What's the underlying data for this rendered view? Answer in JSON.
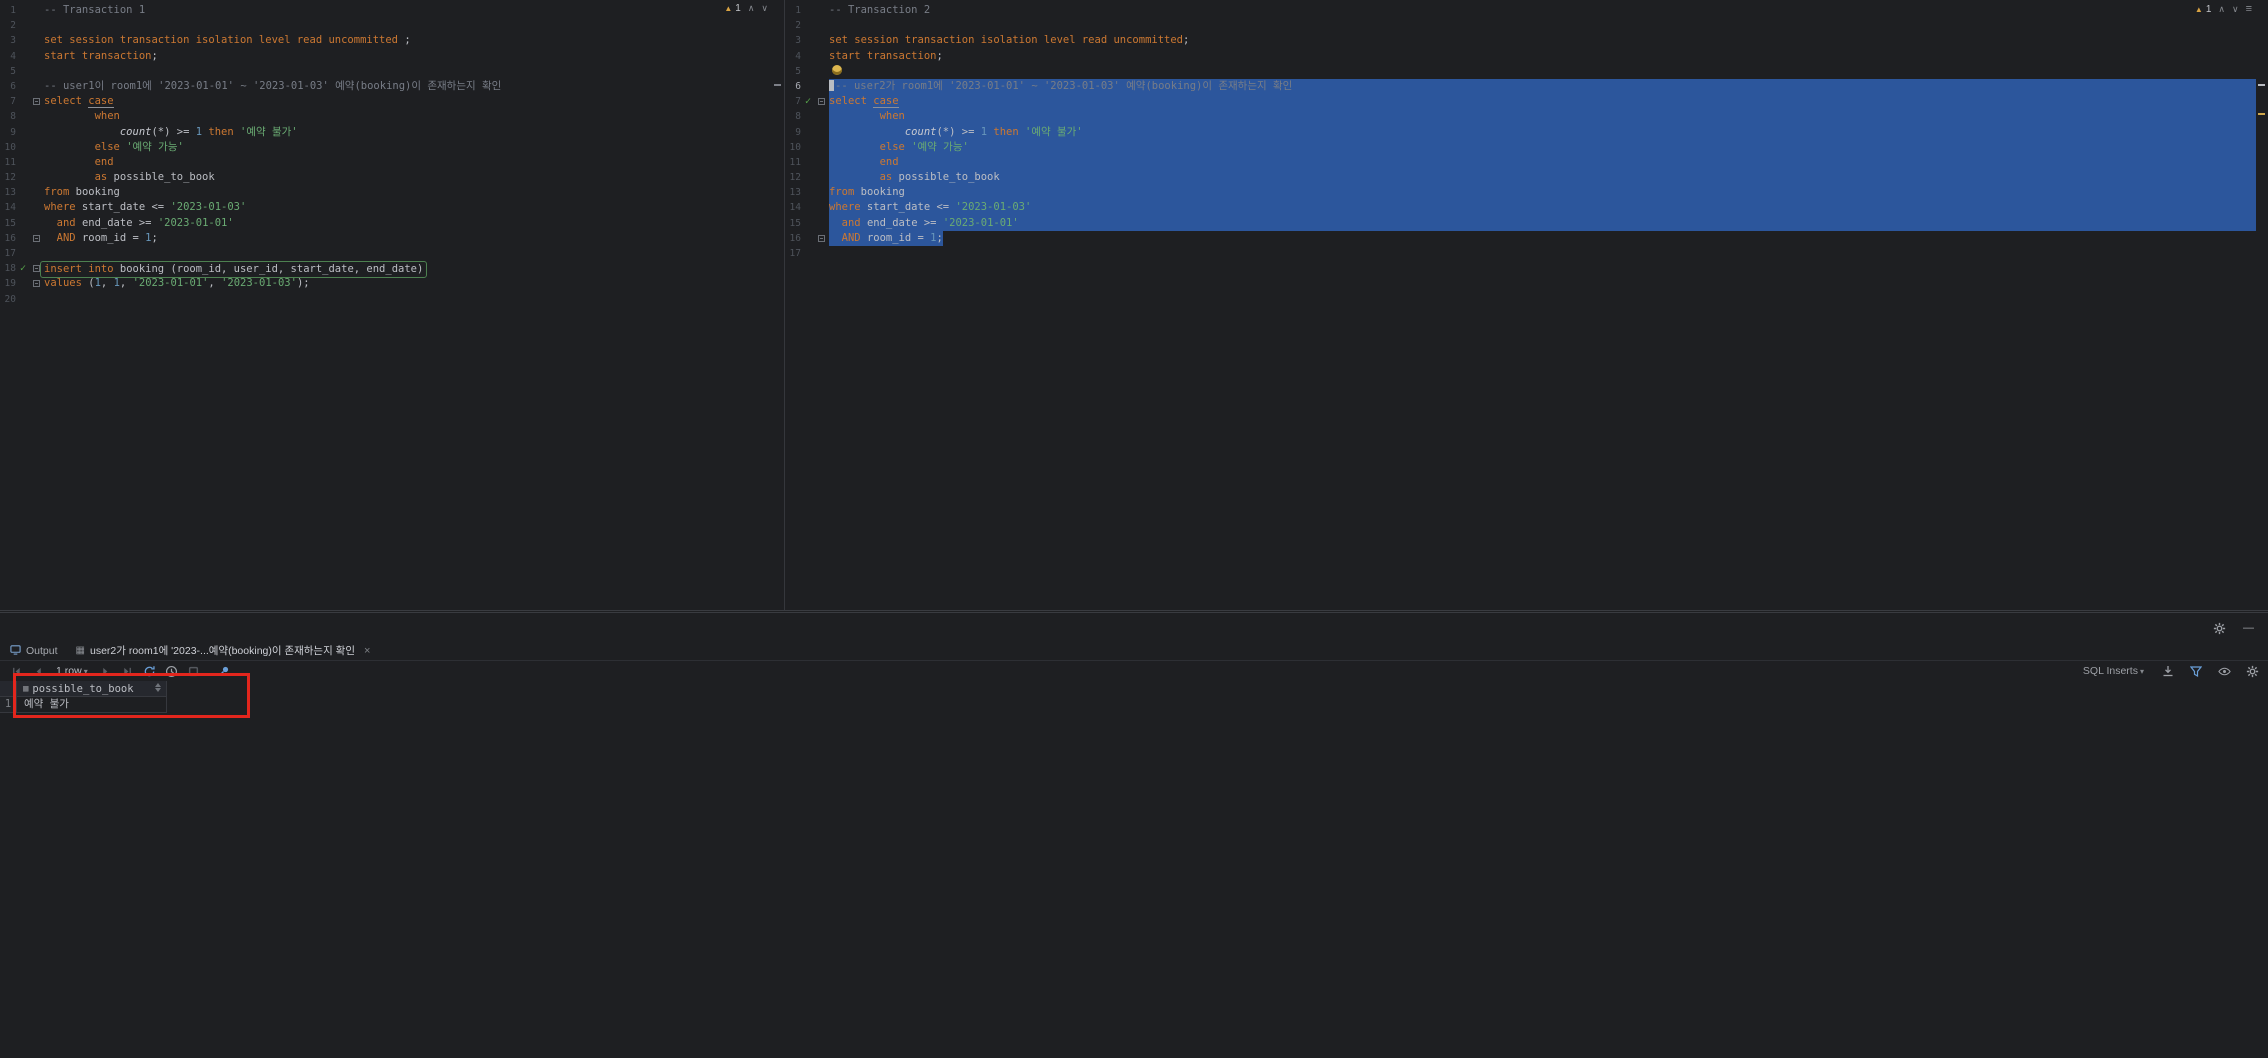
{
  "colors": {
    "selection_blue": "#2c569c",
    "keyword_orange": "#cc7832",
    "string_green": "#6aab73",
    "number_blue": "#6897bb",
    "comment_gray": "#787d87",
    "warning_yellow": "#d9a343",
    "exec_check_green": "#57a64a",
    "annotation_red": "#e3261d",
    "editor_bg": "#1e1f22"
  },
  "editors": [
    {
      "name": "transaction-1",
      "warnings": "1",
      "lines": [
        {
          "n": "1",
          "seg": [
            [
              "cmt",
              "-- Transaction 1"
            ]
          ]
        },
        {
          "n": "2"
        },
        {
          "n": "3",
          "seg": [
            [
              "kw",
              "set session transaction isolation level read uncommitted"
            ],
            [
              "def",
              " ;"
            ]
          ]
        },
        {
          "n": "4",
          "seg": [
            [
              "kw",
              "start transaction"
            ],
            [
              "def",
              ";"
            ]
          ]
        },
        {
          "n": "5"
        },
        {
          "n": "6",
          "seg": [
            [
              "cmt",
              "-- user1이 room1에 '2023-01-01' ~ '2023-01-03' 예약(booking)이 존재하는지 확인"
            ]
          ]
        },
        {
          "n": "7",
          "fold": true,
          "seg": [
            [
              "kw",
              "select "
            ],
            [
              "kwu",
              "case"
            ]
          ]
        },
        {
          "n": "8",
          "seg": [
            [
              "def",
              "        "
            ],
            [
              "kw",
              "when"
            ]
          ]
        },
        {
          "n": "9",
          "seg": [
            [
              "def",
              "            "
            ],
            [
              "fn",
              "count"
            ],
            [
              "def",
              "(*) >= "
            ],
            [
              "num",
              "1"
            ],
            [
              "def",
              " "
            ],
            [
              "kw",
              "then"
            ],
            [
              "def",
              " "
            ],
            [
              "str",
              "'예약 불가'"
            ]
          ]
        },
        {
          "n": "10",
          "seg": [
            [
              "def",
              "        "
            ],
            [
              "kw",
              "else"
            ],
            [
              "def",
              " "
            ],
            [
              "str",
              "'예약 가능'"
            ]
          ]
        },
        {
          "n": "11",
          "seg": [
            [
              "def",
              "        "
            ],
            [
              "kw",
              "end"
            ]
          ]
        },
        {
          "n": "12",
          "seg": [
            [
              "def",
              "        "
            ],
            [
              "kw",
              "as"
            ],
            [
              "def",
              " possible_to_book"
            ]
          ]
        },
        {
          "n": "13",
          "seg": [
            [
              "kw",
              "from"
            ],
            [
              "def",
              " booking"
            ]
          ]
        },
        {
          "n": "14",
          "seg": [
            [
              "kw",
              "where"
            ],
            [
              "def",
              " start_date <= "
            ],
            [
              "str",
              "'2023-01-03'"
            ]
          ]
        },
        {
          "n": "15",
          "seg": [
            [
              "def",
              "  "
            ],
            [
              "kw",
              "and"
            ],
            [
              "def",
              " end_date >= "
            ],
            [
              "str",
              "'2023-01-01'"
            ]
          ]
        },
        {
          "n": "16",
          "fold": true,
          "seg": [
            [
              "def",
              "  "
            ],
            [
              "kw",
              "AND"
            ],
            [
              "def",
              " room_id = "
            ],
            [
              "num",
              "1"
            ],
            [
              "def",
              ";"
            ]
          ]
        },
        {
          "n": "17"
        },
        {
          "n": "18",
          "check": true,
          "fold": true,
          "exec": true,
          "seg": [
            [
              "kw",
              "insert into"
            ],
            [
              "def",
              " booking (room_id, user_id, start_date, end_date)"
            ]
          ]
        },
        {
          "n": "19",
          "fold": true,
          "seg": [
            [
              "kw",
              "values"
            ],
            [
              "def",
              " ("
            ],
            [
              "num",
              "1"
            ],
            [
              "def",
              ", "
            ],
            [
              "num",
              "1"
            ],
            [
              "def",
              ", "
            ],
            [
              "str",
              "'2023-01-01'"
            ],
            [
              "def",
              ", "
            ],
            [
              "str",
              "'2023-01-03'"
            ],
            [
              "def",
              ");"
            ]
          ]
        },
        {
          "n": "20"
        }
      ]
    },
    {
      "name": "transaction-2",
      "warnings": "1",
      "lines": [
        {
          "n": "1",
          "seg": [
            [
              "cmt",
              "-- Transaction 2"
            ]
          ]
        },
        {
          "n": "2"
        },
        {
          "n": "3",
          "seg": [
            [
              "kw",
              "set session transaction isolation level read uncommitted"
            ],
            [
              "def",
              ";"
            ]
          ]
        },
        {
          "n": "4",
          "seg": [
            [
              "kw",
              "start transaction"
            ],
            [
              "def",
              ";"
            ]
          ]
        },
        {
          "n": "5",
          "bulb": true
        },
        {
          "n": "6",
          "cur": true,
          "sel": true,
          "caret": true,
          "seg": [
            [
              "cmt",
              "-- user2가 room1에 '2023-01-01' ~ '2023-01-03' 예약(booking)이 존재하는지 확인"
            ]
          ]
        },
        {
          "n": "7",
          "check": true,
          "fold": true,
          "sel": true,
          "seg": [
            [
              "kw",
              "select "
            ],
            [
              "kwu",
              "case"
            ]
          ]
        },
        {
          "n": "8",
          "sel": true,
          "seg": [
            [
              "def",
              "        "
            ],
            [
              "kw",
              "when"
            ]
          ]
        },
        {
          "n": "9",
          "sel": true,
          "seg": [
            [
              "def",
              "            "
            ],
            [
              "fn",
              "count"
            ],
            [
              "def",
              "(*) >= "
            ],
            [
              "num",
              "1"
            ],
            [
              "def",
              " "
            ],
            [
              "kw",
              "then"
            ],
            [
              "def",
              " "
            ],
            [
              "str",
              "'예약 불가'"
            ]
          ]
        },
        {
          "n": "10",
          "sel": true,
          "seg": [
            [
              "def",
              "        "
            ],
            [
              "kw",
              "else"
            ],
            [
              "def",
              " "
            ],
            [
              "str",
              "'예약 가능'"
            ]
          ]
        },
        {
          "n": "11",
          "sel": true,
          "seg": [
            [
              "def",
              "        "
            ],
            [
              "kw",
              "end"
            ]
          ]
        },
        {
          "n": "12",
          "sel": true,
          "seg": [
            [
              "def",
              "        "
            ],
            [
              "kw",
              "as"
            ],
            [
              "def",
              " possible_to_book"
            ]
          ]
        },
        {
          "n": "13",
          "sel": true,
          "seg": [
            [
              "kw",
              "from"
            ],
            [
              "def",
              " booking"
            ]
          ]
        },
        {
          "n": "14",
          "sel": true,
          "seg": [
            [
              "kw",
              "where"
            ],
            [
              "def",
              " start_date <= "
            ],
            [
              "str",
              "'2023-01-03'"
            ]
          ]
        },
        {
          "n": "15",
          "sel": true,
          "seg": [
            [
              "def",
              "  "
            ],
            [
              "kw",
              "and"
            ],
            [
              "def",
              " end_date >= "
            ],
            [
              "str",
              "'2023-01-01'"
            ]
          ]
        },
        {
          "n": "16",
          "fold": true,
          "selText": true,
          "seg": [
            [
              "def",
              "  "
            ],
            [
              "kw",
              "AND"
            ],
            [
              "def",
              " room_id = "
            ],
            [
              "num",
              "1"
            ],
            [
              "def",
              ";"
            ]
          ]
        },
        {
          "n": "17"
        }
      ]
    }
  ],
  "bottom": {
    "tabs": [
      {
        "label": "Output"
      },
      {
        "label": "user2가 room1에 '2023-...예약(booking)이 존재하는지 확인"
      }
    ],
    "toolbar": {
      "row_count": "1 row",
      "insert_format": "SQL Inserts"
    },
    "grid": {
      "column": "possible_to_book",
      "rows": [
        {
          "num": "1",
          "value": "예약 불가"
        }
      ]
    }
  }
}
